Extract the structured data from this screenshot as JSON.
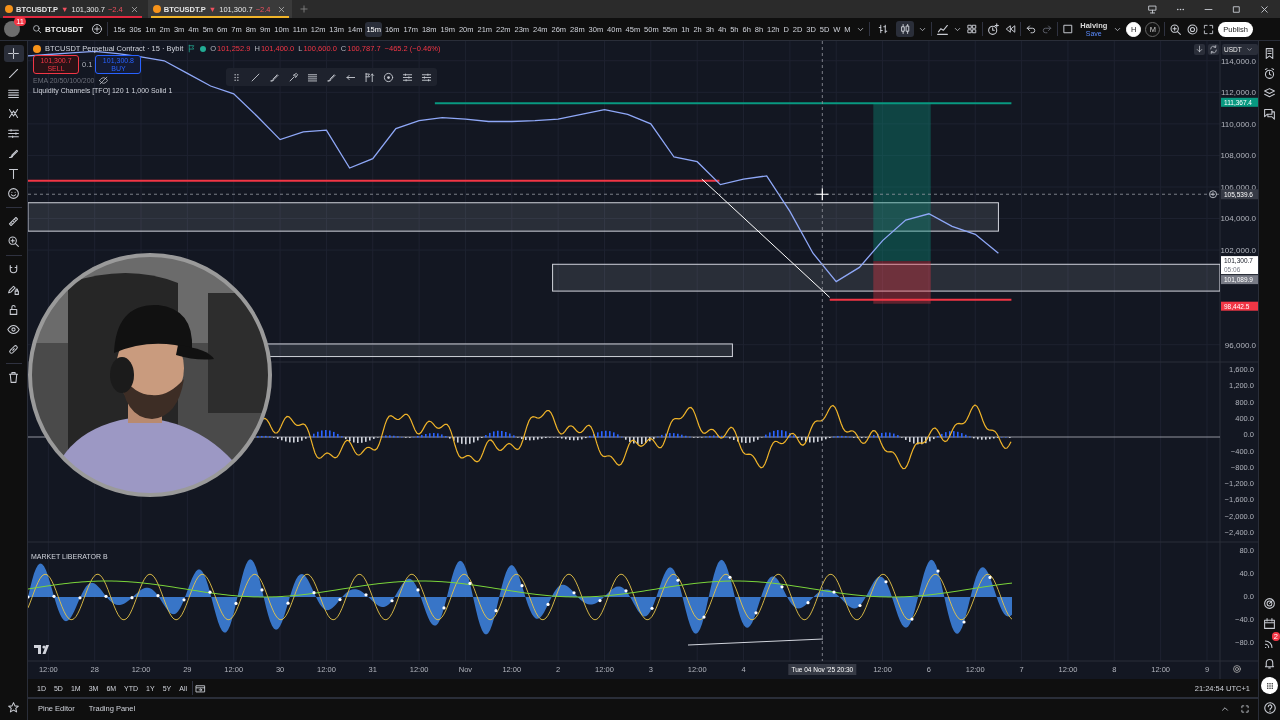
{
  "tabs": [
    {
      "symbol": "BTCUSDT.P",
      "arrow": "▼",
      "price": "101,300.7",
      "change": "−2.4",
      "color": "#e0283f",
      "selected": false
    },
    {
      "symbol": "BTCUSDT.P",
      "arrow": "▼",
      "price": "101,300.7",
      "change": "−2.4",
      "color": "#f0b429",
      "selected": true
    }
  ],
  "toolbar": {
    "badge": "11",
    "symbol": "BTCUSDT",
    "intervals": [
      {
        "label": "15s",
        "selected": false
      },
      {
        "label": "30s",
        "selected": false
      },
      {
        "label": "1m",
        "selected": false
      },
      {
        "label": "2m",
        "selected": false
      },
      {
        "label": "3m",
        "selected": false
      },
      {
        "label": "4m",
        "selected": false
      },
      {
        "label": "5m",
        "selected": false
      },
      {
        "label": "6m",
        "selected": false
      },
      {
        "label": "7m",
        "selected": false
      },
      {
        "label": "8m",
        "selected": false
      },
      {
        "label": "9m",
        "selected": false
      },
      {
        "label": "10m",
        "selected": false
      },
      {
        "label": "11m",
        "selected": false
      },
      {
        "label": "12m",
        "selected": false
      },
      {
        "label": "13m",
        "selected": false
      },
      {
        "label": "14m",
        "selected": false
      },
      {
        "label": "15m",
        "selected": true
      },
      {
        "label": "16m",
        "selected": false
      },
      {
        "label": "17m",
        "selected": false
      },
      {
        "label": "18m",
        "selected": false
      },
      {
        "label": "19m",
        "selected": false
      },
      {
        "label": "20m",
        "selected": false
      },
      {
        "label": "21m",
        "selected": false
      },
      {
        "label": "22m",
        "selected": false
      },
      {
        "label": "23m",
        "selected": false
      },
      {
        "label": "24m",
        "selected": false
      },
      {
        "label": "26m",
        "selected": false
      },
      {
        "label": "28m",
        "selected": false
      },
      {
        "label": "30m",
        "selected": false
      },
      {
        "label": "40m",
        "selected": false
      },
      {
        "label": "45m",
        "selected": false
      },
      {
        "label": "50m",
        "selected": false
      },
      {
        "label": "55m",
        "selected": false
      },
      {
        "label": "1h",
        "selected": false
      },
      {
        "label": "2h",
        "selected": false
      },
      {
        "label": "3h",
        "selected": false
      },
      {
        "label": "4h",
        "selected": false
      },
      {
        "label": "5h",
        "selected": false
      },
      {
        "label": "6h",
        "selected": false
      },
      {
        "label": "8h",
        "selected": false
      },
      {
        "label": "12h",
        "selected": false
      },
      {
        "label": "D",
        "selected": false
      },
      {
        "label": "2D",
        "selected": false
      },
      {
        "label": "3D",
        "selected": false
      },
      {
        "label": "5D",
        "selected": false
      },
      {
        "label": "W",
        "selected": false
      },
      {
        "label": "M",
        "selected": false
      }
    ],
    "chart_types": [
      {
        "selected": false
      },
      {
        "selected": true
      }
    ],
    "layout": {
      "name": "Halving",
      "status": "Save"
    },
    "chips": [
      {
        "label": "H",
        "selected": true
      },
      {
        "label": "M",
        "selected": false
      }
    ],
    "publish": "Publish"
  },
  "drawing_tools": [
    {
      "selected": true
    },
    {
      "selected": false
    },
    {
      "selected": false
    },
    {
      "selected": false
    },
    {
      "selected": false
    },
    {
      "selected": false
    },
    {
      "selected": false
    },
    {
      "selected": false
    },
    {
      "selected": false
    },
    {
      "selected": false
    },
    {
      "selected": false
    },
    {
      "selected": false
    },
    {
      "selected": false
    },
    {
      "selected": false
    },
    {
      "selected": false
    },
    {
      "selected": false
    }
  ],
  "legend": {
    "title": "BTCUSDT Perpetual Contract · 15 · Bybit",
    "ohlc": [
      {
        "label": "O",
        "value": "101,252.9"
      },
      {
        "label": "H",
        "value": "101,400.0"
      },
      {
        "label": "L",
        "value": "100,600.0"
      },
      {
        "label": "C",
        "value": "100,787.7"
      }
    ],
    "change": "−465.2 (−0.46%)",
    "sell": {
      "price": "101,300.7",
      "label": "SELL"
    },
    "quantity": "0.1",
    "buy": {
      "price": "101,300.8",
      "label": "BUY"
    },
    "indicators": [
      "EMA 20/50/100/200",
      "Liquidity Channels [TFO] 120 1 1,000 Solid 1"
    ]
  },
  "currency": "USDT",
  "time_axis": {
    "labels": [
      "12:00",
      "28",
      "12:00",
      "29",
      "12:00",
      "30",
      "12:00",
      "31",
      "12:00",
      "Nov",
      "12:00",
      "2",
      "12:00",
      "3",
      "12:00",
      "4",
      "12:00",
      "6",
      "12:00",
      "7",
      "12:00",
      "8",
      "12:00",
      "9"
    ]
  },
  "price_axis": {
    "ticks": [
      "114,000.0",
      "112,000.0",
      "110,000.0",
      "108,000.0",
      "106,000.0",
      "104,000.0",
      "102,000.0",
      "96,000.0"
    ]
  },
  "price_labels": [
    {
      "kind": "price_label",
      "text": "111,367.4",
      "color": "#089981"
    },
    {
      "kind": "current_price",
      "text": "101,300.7",
      "time": "05:06",
      "color": "#ffffff"
    },
    {
      "kind": "price_label",
      "text": "101,089.9",
      "color": "#787b86"
    },
    {
      "kind": "price_label",
      "text": "98,442.5",
      "color": "#f23645"
    }
  ],
  "crosshair": {
    "price": "105,539.6",
    "time": "Tue 04 Nov '25  20:30"
  },
  "macd_pane": {
    "ticks": [
      "1,600.0",
      "1,200.0",
      "800.0",
      "400.0",
      "0.0",
      "−400.0",
      "−800.0",
      "−1,200.0",
      "−1,600.0",
      "−2,000.0",
      "−2,400.0"
    ]
  },
  "oscillator_pane": {
    "title": "MARKET LIBERATOR B",
    "ticks": [
      "80.0",
      "40.0",
      "0.0",
      "−40.0",
      "−80.0"
    ]
  },
  "range_buttons": [
    "1D",
    "5D",
    "1M",
    "3M",
    "6M",
    "YTD",
    "1Y",
    "5Y",
    "All"
  ],
  "clock": "21:24:54 UTC+1",
  "bottom_tabs": [
    "Pine Editor",
    "Trading Panel"
  ],
  "sidebar": {
    "feed_badge": "2"
  }
}
